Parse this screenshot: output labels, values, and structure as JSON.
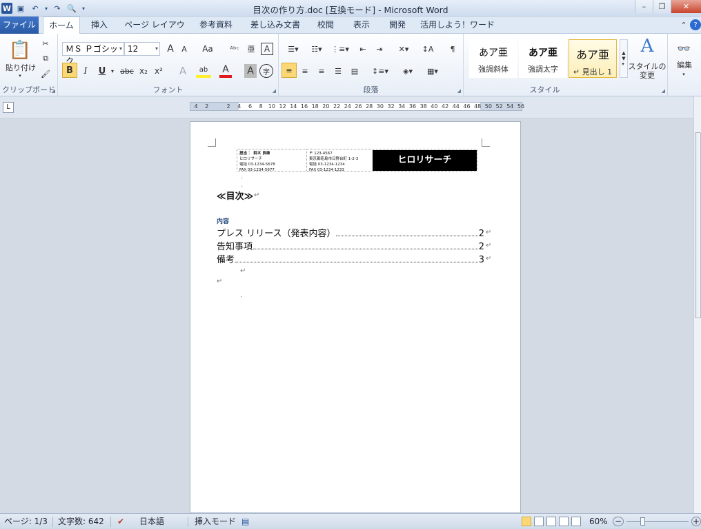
{
  "window": {
    "title": "目次の作り方.doc [互換モード] - Microsoft Word",
    "logo_letter": "W",
    "qat": [
      "save-icon",
      "undo-icon",
      "redo-icon",
      "print-preview-icon",
      "customize-icon"
    ],
    "controls": {
      "minimize": "–",
      "restore": "❐",
      "close": "✕"
    }
  },
  "tabs": [
    {
      "label": "ファイル"
    },
    {
      "label": "ホーム"
    },
    {
      "label": "挿入"
    },
    {
      "label": "ページ レイアウト"
    },
    {
      "label": "参考資料"
    },
    {
      "label": "差し込み文書"
    },
    {
      "label": "校閲"
    },
    {
      "label": "表示"
    },
    {
      "label": "開発"
    },
    {
      "label": "活用しよう！ワード"
    }
  ],
  "ribbon": {
    "clipboard": {
      "paste_label": "貼り付け",
      "group_label": "クリップボード"
    },
    "font": {
      "font_name": "ＭＳ Ｐゴシック",
      "font_size": "12",
      "group_label": "フォント",
      "bold": "B",
      "italic": "I",
      "underline": "U",
      "strike": "abc",
      "sub": "x₂",
      "sup": "x²",
      "grow": "A",
      "shrink": "A",
      "case": "Aa",
      "clear": "A",
      "char_border": "A",
      "enclose": "字"
    },
    "paragraph": {
      "group_label": "段落"
    },
    "styles": {
      "group_label": "スタイル",
      "items": [
        {
          "preview": "あア亜",
          "name": "強調斜体"
        },
        {
          "preview": "あア亜",
          "name": "強調太字"
        },
        {
          "preview": "あア亜",
          "name": "↵ 見出し 1"
        }
      ],
      "change_label": "スタイルの変更"
    },
    "editing": {
      "label": "編集"
    }
  },
  "ruler": {
    "ticks": [
      "4",
      "2",
      "",
      "2",
      "4",
      "6",
      "8",
      "10",
      "12",
      "14",
      "16",
      "18",
      "20",
      "22",
      "24",
      "26",
      "28",
      "30",
      "32",
      "34",
      "36",
      "38",
      "40",
      "42",
      "44",
      "46",
      "48",
      "50",
      "52",
      "54",
      "56"
    ]
  },
  "document": {
    "header": {
      "col1": [
        "担当 ： 鈴木 良雄",
        "ヒロリサーチ",
        "電話 03-1234-5678",
        "FAX 03-1234-5677"
      ],
      "col2": [
        "〒 123-4567",
        "東京都昭島市日野台町 1-2-3",
        "電話 03-1234-1234",
        "FAX 03-1234-1233"
      ],
      "logo_text": "ヒロリサーチ"
    },
    "toc_title": "≪目次≫",
    "toc_heading": "内容",
    "toc_entries": [
      {
        "label": "プレス リリース（発表内容）",
        "page": "2"
      },
      {
        "label": "告知事項",
        "page": "2"
      },
      {
        "label": "備考",
        "page": "3"
      }
    ]
  },
  "status": {
    "page": "ページ: 1/3",
    "words": "文字数: 642",
    "language": "日本語",
    "mode": "挿入モード",
    "zoom": "60%"
  }
}
